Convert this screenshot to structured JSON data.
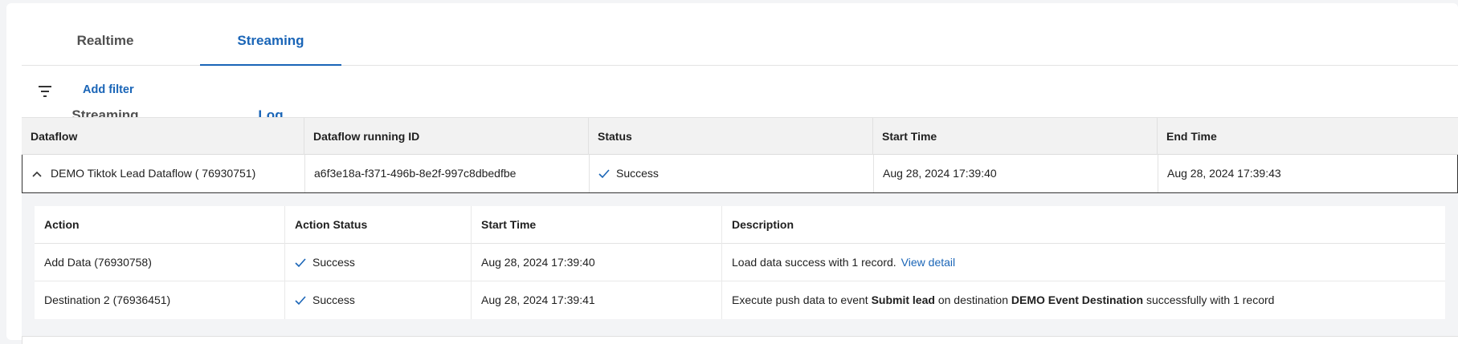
{
  "tabs": [
    {
      "label": "Realtime Streaming",
      "active": false
    },
    {
      "label": "Streaming Log",
      "active": true
    }
  ],
  "filter": {
    "add_label": "Add filter",
    "icon": "filter-icon"
  },
  "table": {
    "columns": [
      "Dataflow",
      "Dataflow running ID",
      "Status",
      "Start Time",
      "End Time"
    ],
    "rows": [
      {
        "dataflow": "DEMO Tiktok Lead Dataflow ( 76930751)",
        "running_id": "a6f3e18a-f371-496b-8e2f-997c8dbedfbe",
        "status": "Success",
        "start_time": "Aug 28, 2024 17:39:40",
        "end_time": "Aug 28, 2024 17:39:43",
        "expanded": true
      }
    ]
  },
  "sub_table": {
    "columns": [
      "Action",
      "Action Status",
      "Start Time",
      "Description"
    ],
    "rows": [
      {
        "action": "Add Data (76930758)",
        "status": "Success",
        "start_time": "Aug 28, 2024 17:39:40",
        "description": "Load data success with 1 record.",
        "link": "View detail"
      },
      {
        "action": "Destination 2 (76936451)",
        "status": "Success",
        "start_time": "Aug 28, 2024 17:39:41",
        "desc_pre": "Execute push data to event",
        "desc_event": "Submit lead",
        "desc_mid": "on destination",
        "desc_dest": "DEMO Event Destination",
        "desc_post": "successfully with 1 record"
      }
    ]
  },
  "colors": {
    "accent": "#1a65b7",
    "success": "#1a65b7"
  }
}
